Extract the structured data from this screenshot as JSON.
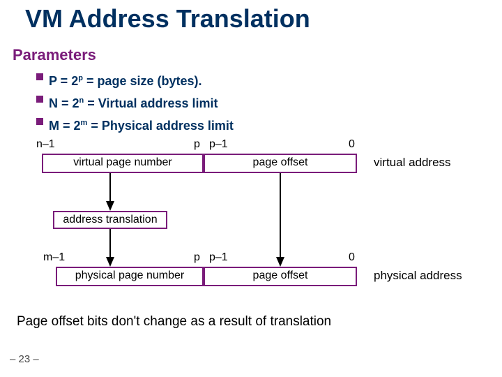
{
  "title": "VM Address Translation",
  "subhead": "Parameters",
  "bullets": [
    {
      "lhs": "P = 2",
      "exp": "p",
      "rhs": " = page size (bytes)."
    },
    {
      "lhs": "N = 2",
      "exp": "n",
      "rhs": " = Virtual address limit"
    },
    {
      "lhs": "M = 2",
      "exp": "m",
      "rhs": " = Physical address limit"
    }
  ],
  "virtual": {
    "left_bit": "n–1",
    "mid_right": "p",
    "mid_left": "p–1",
    "right_bit": "0",
    "vpn": "virtual page number",
    "offset": "page offset",
    "label": "virtual address"
  },
  "at_box": "address translation",
  "physical": {
    "left_bit": "m–1",
    "mid_right": "p",
    "mid_left": "p–1",
    "right_bit": "0",
    "ppn": "physical page number",
    "offset": "page offset",
    "label": "physical address"
  },
  "footer": "Page offset bits don't change as a result of translation",
  "pagenum": "– 23 –"
}
